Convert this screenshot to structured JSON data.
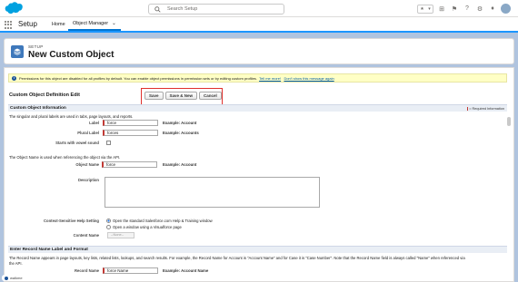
{
  "header": {
    "search_placeholder": "Search Setup",
    "icons": [
      "star-icon",
      "add-icon",
      "help-icon",
      "gear-icon",
      "bell-icon",
      "avatar"
    ]
  },
  "nav": {
    "app_name": "Setup",
    "tabs": [
      {
        "label": "Home"
      },
      {
        "label": "Object Manager"
      }
    ]
  },
  "page_header": {
    "breadcrumb": "SETUP",
    "title": "New Custom Object"
  },
  "info_message": {
    "text": "Permissions for this object are disabled for all profiles by default. You can enable object permissions in permission sets or by editing custom profiles.",
    "link1": "Tell me more!",
    "link2": "Don't show this message again"
  },
  "form": {
    "title": "Custom Object Definition Edit",
    "buttons": {
      "save": "Save",
      "save_new": "Save & New",
      "cancel": "Cancel"
    },
    "section1": {
      "title": "Custom Object Information",
      "required_note": "= Required Information",
      "desc1": "The singular and plural labels are used in tabs, page layouts, and reports.",
      "label": {
        "label": "Label",
        "value": "force",
        "example": "Example:  Account"
      },
      "plural": {
        "label": "Plural Label",
        "value": "forces",
        "example": "Example:  Accounts"
      },
      "vowel": {
        "label": "Starts with vowel sound"
      },
      "desc2": "The Object Name is used when referencing the object via the API.",
      "object_name": {
        "label": "Object Name",
        "value": "force",
        "example": "Example:  Account"
      },
      "description": {
        "label": "Description"
      },
      "help_setting": {
        "label": "Context-Sensitive Help Setting",
        "opt1": "Open the standard Salesforce.com Help & Training window",
        "opt2": "Open a window using a Visualforce page"
      },
      "content_name": {
        "label": "Content Name",
        "value": "--None--"
      }
    },
    "section2": {
      "title": "Enter Record Name Label and Format",
      "desc": "The Record Name appears in page layouts, key lists, related lists, lookups, and search results. For example, the Record Name for Account is \"Account Name\" and for Case it is \"Case Number\". Note that the Record Name field is always called \"Name\" when referenced via",
      "desc_cont": "the API.",
      "record_name": {
        "label": "Record Name",
        "value": "force Name",
        "example": "Example:  Account Name"
      }
    }
  },
  "footer": {
    "badge": "walkme"
  },
  "colors": {
    "accent": "#0176d3",
    "background": "#b0c4df",
    "highlight": "#e0312d",
    "object_icon": "#3e78bb"
  }
}
